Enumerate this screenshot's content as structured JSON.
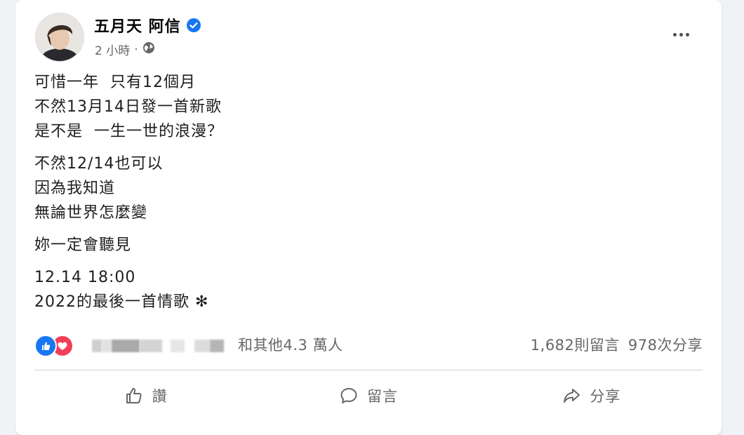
{
  "post": {
    "author": "五月天 阿信",
    "time": "2 小時",
    "separator": "·",
    "privacy_icon": "globe-icon",
    "more_icon": "more-options-icon",
    "paragraphs": [
      [
        "可惜一年  只有12個月",
        "不然13月14日發一首新歌",
        "是不是  一生一世的浪漫？"
      ],
      [
        "不然12/14也可以",
        "因為我知道",
        "無論世界怎麼變"
      ],
      [
        "妳一定會聽見"
      ],
      [
        "12.14 18:00",
        "2022的最後一首情歌 ✻"
      ]
    ]
  },
  "reactions": {
    "icons": [
      "like-reaction-icon",
      "love-reaction-icon"
    ],
    "others_text": "和其他4.3 萬人",
    "comments": "1,682則留言",
    "shares": "978次分享"
  },
  "actions": {
    "like_label": "讚",
    "comment_label": "留言",
    "share_label": "分享"
  },
  "colors": {
    "like_blue": "#1877f2",
    "love_red": "#f33e58",
    "verified_blue": "#1877f2",
    "secondary_text": "#65676b"
  }
}
